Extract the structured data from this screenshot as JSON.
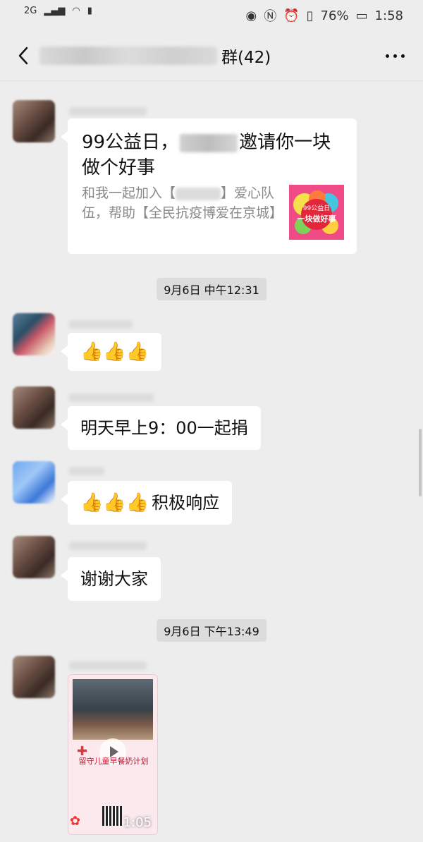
{
  "status_bar": {
    "network": "2G",
    "battery_percent": "76%",
    "time": "1:58"
  },
  "header": {
    "title_suffix": "群(42)"
  },
  "messages": {
    "card": {
      "title_a": "99公益日，",
      "title_b": "邀请你一块做个好事",
      "desc_a": "和我一起加入【",
      "desc_b": "】爱心队伍，帮助【全民抗疫博爱在京城】",
      "image_top": "99公益日",
      "image_bottom": "一块做好事"
    },
    "ts1": "9月6日 中午12:31",
    "m2": "👍👍👍",
    "m3": "明天早上9：00一起捐",
    "m4_thumbs": "👍👍👍",
    "m4_text": "积极响应",
    "m5": "谢谢大家",
    "ts2": "9月6日 下午13:49",
    "video": {
      "title": "留守儿童早餐奶计划",
      "duration": "1:05"
    }
  },
  "colors": {
    "background": "#ededed",
    "bubble": "#ffffff",
    "timestamp_bg": "#dcdcdc"
  }
}
